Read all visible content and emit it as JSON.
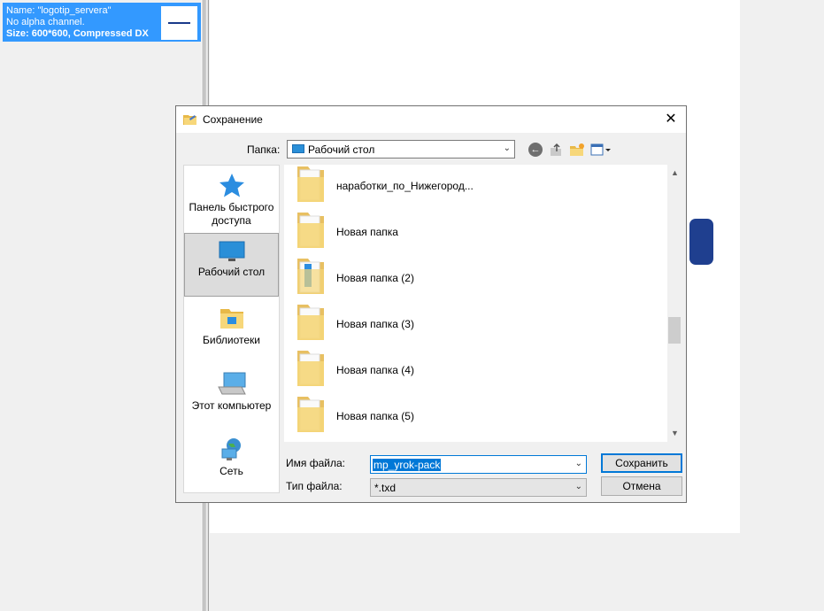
{
  "texture_list": {
    "item": {
      "name_line": "Name: \"logotip_servera\"",
      "alpha_line": "No alpha channel.",
      "size_line": "Size: 600*600, Compressed DX"
    }
  },
  "dialog": {
    "title": "Сохранение",
    "close_symbol": "✕",
    "look_in_label": "Папка:",
    "look_in_value": "Рабочий стол",
    "places": [
      {
        "label": "Панель быстрого доступа",
        "icon": "star-icon"
      },
      {
        "label": "Рабочий стол",
        "icon": "desktop-icon"
      },
      {
        "label": "Библиотеки",
        "icon": "libraries-icon"
      },
      {
        "label": "Этот компьютер",
        "icon": "computer-icon"
      },
      {
        "label": "Сеть",
        "icon": "network-icon"
      }
    ],
    "files": [
      {
        "name": "наработки_по_Нижегород..."
      },
      {
        "name": "Новая папка"
      },
      {
        "name": "Новая папка (2)"
      },
      {
        "name": "Новая папка (3)"
      },
      {
        "name": "Новая папка (4)"
      },
      {
        "name": "Новая папка (5)"
      }
    ],
    "file_name_label": "Имя файла:",
    "file_name_value": "mp_yrok-pack",
    "file_type_label": "Тип файла:",
    "file_type_value": "*.txd",
    "save_button": "Сохранить",
    "cancel_button": "Отмена"
  },
  "colors": {
    "selection_blue": "#3399ff",
    "accent": "#0078d7",
    "folder_yellow": "#f5d679"
  }
}
